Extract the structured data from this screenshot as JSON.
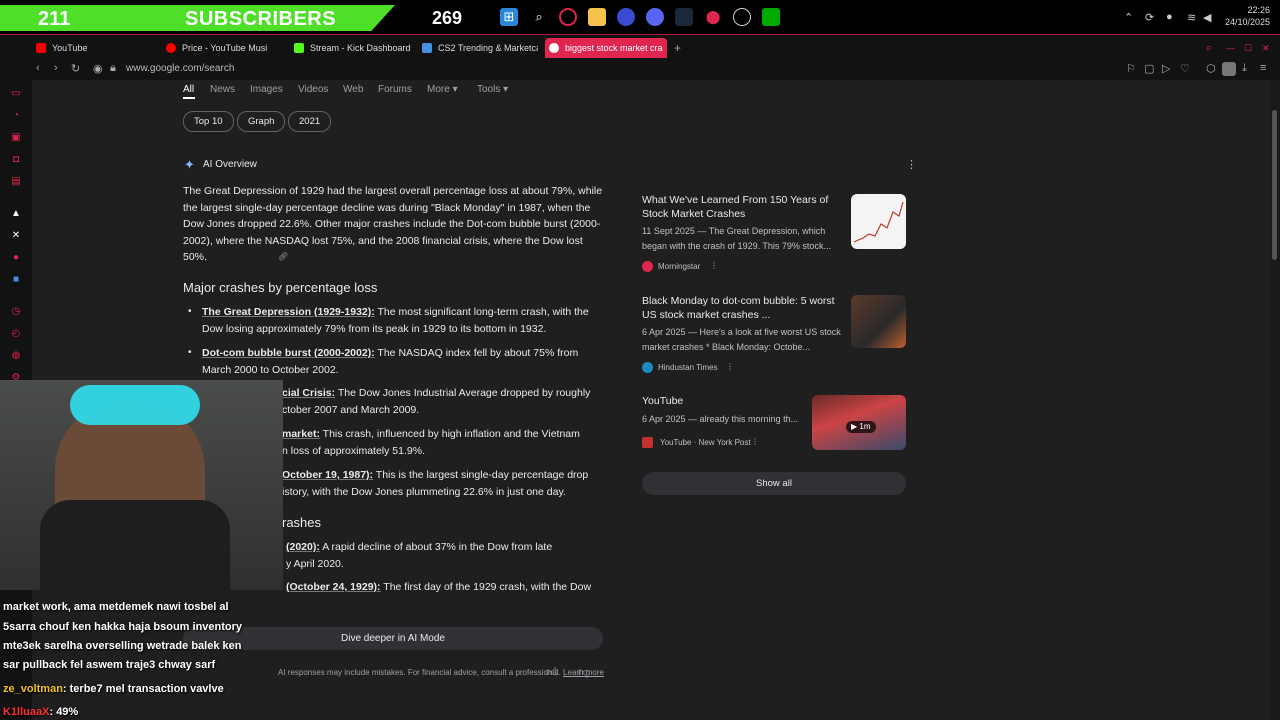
{
  "overlay": {
    "subscribers_count": "211",
    "subscribers_label": "SUBSCRIBERS",
    "secondary_count": "269",
    "clock_time": "22:26",
    "clock_date": "24/10/2025",
    "accent_color": "#4ee028"
  },
  "browser": {
    "tabs": [
      {
        "label": "YouTube",
        "icon": "youtube-icon",
        "color": "#ff0000"
      },
      {
        "label": "Price - YouTube Musi",
        "icon": "youtube-music-icon",
        "color": "#ff0000"
      },
      {
        "label": "Stream - Kick Dashboard",
        "icon": "kick-icon",
        "color": "#53fc18"
      },
      {
        "label": "CS2 Trending & Marketca",
        "icon": "cs2-icon",
        "color": "#4a90e2"
      },
      {
        "label": "biggest stock market cra",
        "icon": "google-icon",
        "color": "#ffffff",
        "active": true
      }
    ],
    "url": "www.google.com/search",
    "accent_color": "#e0264f"
  },
  "google": {
    "nav_tabs": [
      "All",
      "News",
      "Images",
      "Videos",
      "Web",
      "Forums",
      "More",
      "Tools"
    ],
    "chips": [
      "Top 10",
      "Graph",
      "2021"
    ],
    "ai_overview_title": "AI Overview",
    "intro_paragraph": "The Great Depression of 1929 had the largest overall percentage loss at about 79%, while the largest single-day percentage decline was during \"Black Monday\" in 1987, when the Dow Jones dropped 22.6%. Other major crashes include the Dot-com bubble burst (2000-2002), where the NASDAQ lost 75%, and the 2008 financial crisis, where the Dow lost 50%.",
    "major_heading": "Major crashes by percentage loss",
    "bullets": [
      {
        "title": "The Great Depression (1929-1932):",
        "text": " The most significant long-term crash, with the Dow losing approximately 79% from its peak in 1929 to its bottom in 1932."
      },
      {
        "title": "Dot-com bubble burst (2000-2002):",
        "text": " The NASDAQ index fell by about 75% from March 2000 to October 2002."
      },
      {
        "title": "cial Crisis:",
        "text": " The Dow Jones Industrial Average dropped by roughly",
        "text2": "ctober 2007 and March 2009."
      },
      {
        "title": "market:",
        "text": " This crash, influenced by high inflation and the Vietnam",
        "text2": "n loss of approximately 51.9%."
      },
      {
        "title": "October 19, 1987):",
        "text": " This is the largest single-day percentage drop",
        "text2": "istory, with the Dow Jones plummeting 22.6% in just one day."
      }
    ],
    "crashes_heading": "rashes",
    "bullets2": [
      {
        "title": "(2020):",
        "text": " A rapid decline of about 37% in the Dow from late",
        "text2": "y April 2020."
      },
      {
        "title": "(October 24, 1929):",
        "text": " The first day of the 1929 crash, with the Dow"
      }
    ],
    "dive_deeper": "Dive deeper in AI Mode",
    "disclaimer": "AI responses may include mistakes. For financial advice, consult a professional.",
    "learn_more": "Learn more"
  },
  "sources": [
    {
      "title": "What We've Learned From 150 Years of Stock Market Crashes",
      "snippet": "11 Sept 2025 — The Great Depression, which began with the crash of 1929. This 79% stock...",
      "source": "Morningstar"
    },
    {
      "title": "Black Monday to dot-com bubble: 5 worst US stock market crashes ...",
      "snippet": "6 Apr 2025 — Here's a look at five worst US stock market crashes * Black Monday: Octobe...",
      "source": "Hindustan Times"
    },
    {
      "title": "YouTube",
      "snippet": "6 Apr 2025 — already this morning th...",
      "source": "YouTube · New York Post",
      "duration": "1m"
    }
  ],
  "show_all": "Show all",
  "chat": [
    {
      "text": "market work, ama metdemek nawi tosbel al"
    },
    {
      "text": "5sarra chouf ken hakka haja bsoum inventory"
    },
    {
      "text": "mte3ek sarelha overselling wetrade balek ken"
    },
    {
      "text": "sar pullback fel aswem traje3 chway sarf"
    },
    {
      "user": "ze_voltman",
      "text": ": terbe7 mel transaction vavlve"
    },
    {
      "user": "K1lluaaX",
      "text": ": 49%"
    }
  ]
}
